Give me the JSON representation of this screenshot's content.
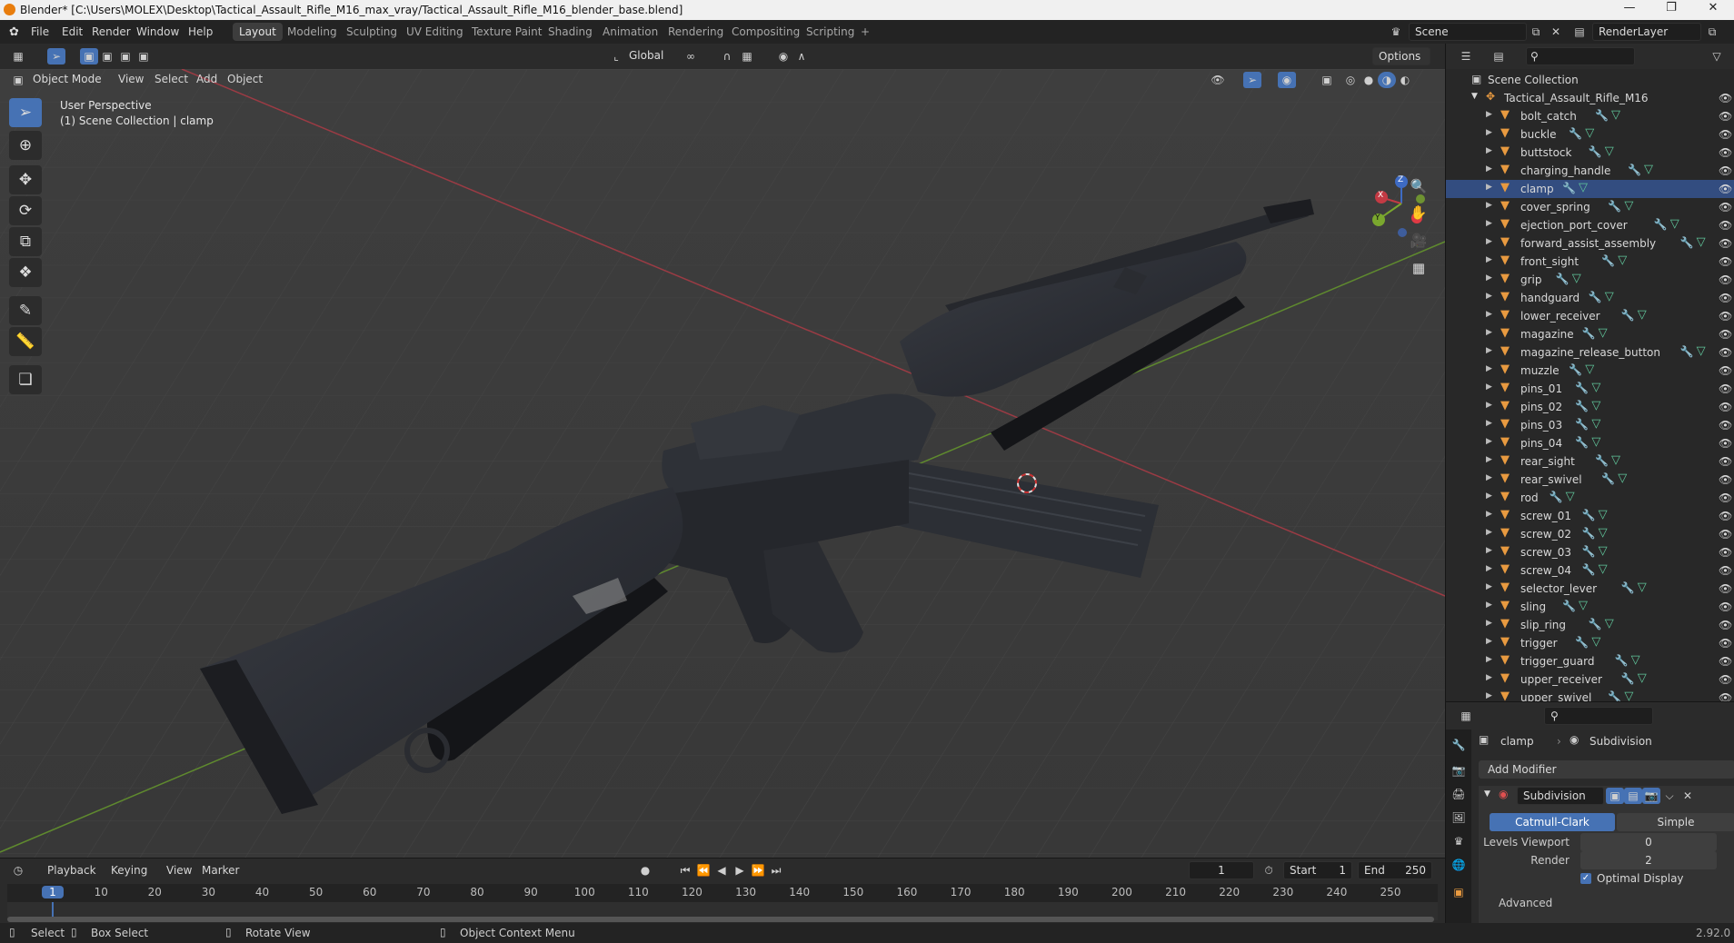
{
  "window": {
    "title": "Blender* [C:\\Users\\MOLEX\\Desktop\\Tactical_Assault_Rifle_M16_max_vray/Tactical_Assault_Rifle_M16_blender_base.blend]",
    "min_icon": "minimize-icon",
    "max_icon": "restore-icon",
    "close_icon": "close-icon"
  },
  "menu": [
    "File",
    "Edit",
    "Render",
    "Window",
    "Help"
  ],
  "workspaces": [
    "Layout",
    "Modeling",
    "Sculpting",
    "UV Editing",
    "Texture Paint",
    "Shading",
    "Animation",
    "Rendering",
    "Compositing",
    "Scripting",
    "+"
  ],
  "scene": {
    "name": "Scene",
    "view_layer": "RenderLayer"
  },
  "tool_header": {
    "orientation": "Global",
    "options": "Options"
  },
  "viewport_header": {
    "mode": "Object Mode",
    "menus": [
      "View",
      "Select",
      "Add",
      "Object"
    ]
  },
  "viewport": {
    "perspective": "User Perspective",
    "collection_info": "(1) Scene Collection | clamp",
    "gizmo": {
      "x": "X",
      "y": "Y",
      "z": "Z"
    }
  },
  "outliner": {
    "root": "Scene Collection",
    "collection": "Tactical_Assault_Rifle_M16",
    "objects": [
      "bolt_catch",
      "buckle",
      "buttstock",
      "charging_handle",
      "clamp",
      "cover_spring",
      "ejection_port_cover",
      "forward_assist_assembly",
      "front_sight",
      "grip",
      "handguard",
      "lower_receiver",
      "magazine",
      "magazine_release_button",
      "muzzle",
      "pins_01",
      "pins_02",
      "pins_03",
      "pins_04",
      "rear_sight",
      "rear_swivel",
      "rod",
      "screw_01",
      "screw_02",
      "screw_03",
      "screw_04",
      "selector_lever",
      "sling",
      "slip_ring",
      "trigger",
      "trigger_guard",
      "upper_receiver",
      "upper_swivel"
    ],
    "selected": "clamp"
  },
  "properties": {
    "object": "clamp",
    "modifier_tab": "Subdivision",
    "add_modifier": "Add Modifier",
    "modifier_name": "Subdivision",
    "mode_a": "Catmull-Clark",
    "mode_b": "Simple",
    "levels_viewport_label": "Levels Viewport",
    "levels_viewport": "0",
    "render_label": "Render",
    "render_value": "2",
    "optimal_display": "Optimal Display",
    "advanced": "Advanced"
  },
  "timeline": {
    "menus": [
      "Playback",
      "Keying",
      "View",
      "Marker"
    ],
    "current_frame": "1",
    "start_label": "Start",
    "start": "1",
    "end_label": "End",
    "end": "250",
    "ticks": [
      "1",
      "10",
      "20",
      "30",
      "40",
      "50",
      "60",
      "70",
      "80",
      "90",
      "100",
      "110",
      "120",
      "130",
      "140",
      "150",
      "160",
      "170",
      "180",
      "190",
      "200",
      "210",
      "220",
      "230",
      "240",
      "250"
    ]
  },
  "status": {
    "select": "Select",
    "box_select": "Box Select",
    "rotate": "Rotate View",
    "context": "Object Context Menu",
    "version": "2.92.0"
  },
  "colors": {
    "accent": "#4672b4",
    "object_icon": "#e89a40",
    "mesh_icon": "#61c69b",
    "modifier_icon": "#6f9fe0",
    "playhead": "#4672b4"
  }
}
